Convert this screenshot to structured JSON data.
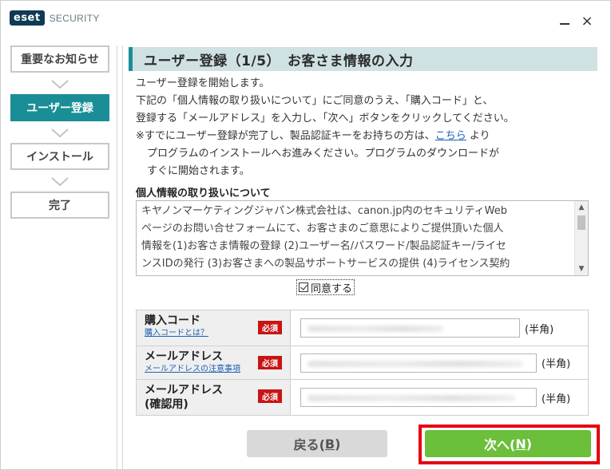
{
  "titlebar": {
    "logo": "eset",
    "product": "SECURITY",
    "minimize_icon": "minimize-icon",
    "close_icon": "close-icon",
    "close_glyph": "×"
  },
  "sidebar": {
    "steps": [
      {
        "label": "重要なお知らせ",
        "active": false
      },
      {
        "label": "ユーザー登録",
        "active": true
      },
      {
        "label": "インストール",
        "active": false
      },
      {
        "label": "完了",
        "active": false
      }
    ]
  },
  "main": {
    "title": "ユーザー登録（1/5）　お客さま情報の入力",
    "intro": {
      "line1": "ユーザー登録を開始します。",
      "line2": "下記の「個人情報の取り扱いについて」にご同意のうえ、「購入コード」と、",
      "line3": "登録する「メールアドレス」を入力し、「次へ」ボタンをクリックしてください。",
      "line4_pre": "※すでにユーザー登録が完了し、製品認証キーをお持ちの方は、",
      "line4_link": "こちら",
      "line4_post": "より",
      "line5": "プログラムのインストールへお進みください。プログラムのダウンロードが",
      "line6": "すぐに開始されます。"
    },
    "privacy": {
      "title": "個人情報の取り扱いについて",
      "lines": [
        "キヤノンマーケティングジャパン株式会社は、canon.jp内のセキュリティWeb",
        "ページのお問い合せフォームにて、お客さまのご意思によりご提供頂いた個人",
        "情報を(1)お客さま情報の登録 (2)ユーザー名/パスワード/製品認証キー/ライセ",
        "ンスIDの発行 (3)お客さまへの製品サポートサービスの提供 (4)ライセンス契約"
      ],
      "scroll_up": "▲",
      "scroll_down": "▼"
    },
    "agree": {
      "label": "同意する",
      "checked": true
    },
    "form": {
      "rows": [
        {
          "label": "購入コード",
          "sublabel": "購入コードとは？",
          "required": "必須",
          "unit": "(半角)"
        },
        {
          "label": "メールアドレス",
          "sublabel": "メールアドレスの注意事項",
          "required": "必須",
          "unit": "(半角)"
        },
        {
          "label": "メールアドレス",
          "label2": "(確認用)",
          "required": "必須",
          "unit": "(半角)"
        }
      ]
    },
    "buttons": {
      "back_pre": "戻る(",
      "back_key": "B",
      "back_post": ")",
      "next_pre": "次へ(",
      "next_key": "N",
      "next_post": ")"
    }
  },
  "colors": {
    "accent": "#1a8e96",
    "header_bg": "#cfe1e3",
    "next_button": "#6bbf3a",
    "required_badge": "#c81414",
    "highlight": "#e60012"
  }
}
